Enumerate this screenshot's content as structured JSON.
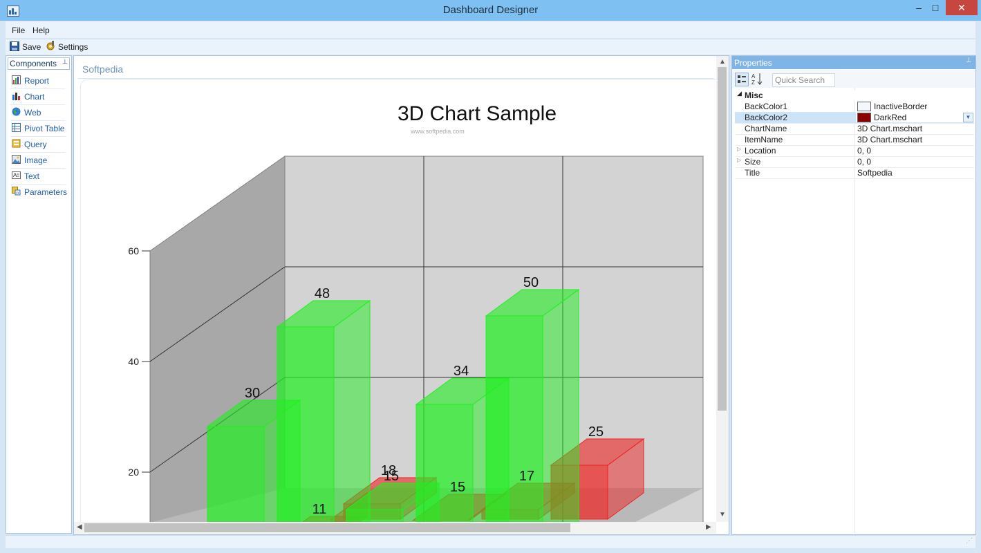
{
  "window": {
    "title": "Dashboard Designer",
    "minimize": "–",
    "maximize": "□",
    "close": "✕"
  },
  "menu": {
    "items": [
      "File",
      "Help"
    ]
  },
  "toolbar": {
    "save_label": "Save",
    "settings_label": "Settings"
  },
  "components": {
    "header": "Components",
    "pin": "📌",
    "items": [
      {
        "label": "Report",
        "icon": "report-icon"
      },
      {
        "label": "Chart",
        "icon": "chart-icon"
      },
      {
        "label": "Web",
        "icon": "globe-icon"
      },
      {
        "label": "Pivot Table",
        "icon": "pivot-table-icon"
      },
      {
        "label": "Query",
        "icon": "query-icon"
      },
      {
        "label": "Image",
        "icon": "image-icon"
      },
      {
        "label": "Text",
        "icon": "text-icon"
      },
      {
        "label": "Parameters",
        "icon": "parameters-icon"
      }
    ]
  },
  "designer": {
    "title": "Softpedia",
    "watermark": "www.softpedia.com"
  },
  "chart_data": {
    "type": "bar",
    "title": "3D Chart Sample",
    "ylim": [
      0,
      60
    ],
    "yticks": [
      20,
      40,
      60
    ],
    "grid": true,
    "series": [
      {
        "color": "#22ee22",
        "values": [
          30,
          48,
          null,
          34,
          50
        ]
      },
      {
        "color": "#ee2222",
        "values": [
          null,
          11,
          18,
          15,
          17,
          25
        ]
      },
      {
        "color": "#22ee22",
        "values": [
          null,
          null,
          15
        ]
      }
    ],
    "data_labels": [
      "30",
      "48",
      "18",
      "34",
      "50",
      "25",
      "11",
      "15",
      "15",
      "17"
    ]
  },
  "properties": {
    "header": "Properties",
    "pin": "📌",
    "search_placeholder": "Quick Search",
    "category": "Misc",
    "rows": [
      {
        "name": "BackColor1",
        "value": "InactiveBorder",
        "swatch": "#f4f7fc"
      },
      {
        "name": "BackColor2",
        "value": "DarkRed",
        "swatch": "#8b0000"
      },
      {
        "name": "ChartName",
        "value": "3D Chart.mschart"
      },
      {
        "name": "ItemName",
        "value": "3D Chart.mschart"
      },
      {
        "name": "Location",
        "value": "0, 0"
      },
      {
        "name": "Size",
        "value": "0, 0"
      },
      {
        "name": "Title",
        "value": "Softpedia"
      }
    ]
  }
}
